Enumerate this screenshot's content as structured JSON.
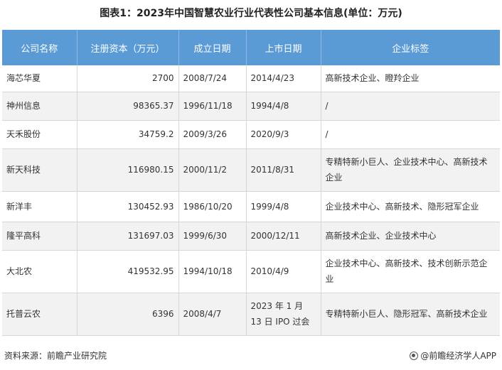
{
  "title": "图表1：2023年中国智慧农业行业代表性公司基本信息(单位：万元)",
  "table": {
    "headers": [
      "公司名称",
      "注册资本（万元）",
      "成立日期",
      "上市日期",
      "企业标签"
    ],
    "rows": [
      {
        "company": "海芯华夏",
        "capital": "2700",
        "founded": "2008/7/24",
        "listed": "2014/4/23",
        "tags": "高新技术企业、瞪羚企业"
      },
      {
        "company": "神州信息",
        "capital": "98365.37",
        "founded": "1996/11/18",
        "listed": "1994/4/8",
        "tags": "/"
      },
      {
        "company": "天禾股份",
        "capital": "34759.2",
        "founded": "2009/3/26",
        "listed": "2020/9/3",
        "tags": "/"
      },
      {
        "company": "新天科技",
        "capital": "116980.15",
        "founded": "2000/11/2",
        "listed": "2011/8/31",
        "tags": "专精特新小巨人、企业技术中心、高新技术企业"
      },
      {
        "company": "新洋丰",
        "capital": "130452.93",
        "founded": "1986/10/20",
        "listed": "1999/4/8",
        "tags": "企业技术中心、高新技术、隐形冠军企业"
      },
      {
        "company": "隆平高科",
        "capital": "131697.03",
        "founded": "1999/6/30",
        "listed": "2000/12/11",
        "tags": "高新技术企业、企业技术中心"
      },
      {
        "company": "大北农",
        "capital": "419532.95",
        "founded": "1994/10/18",
        "listed": "2010/4/9",
        "tags": "企业技术中心、高新技术、技术创新示范企业"
      },
      {
        "company": "托普云农",
        "capital": "6396",
        "founded": "2008/4/7",
        "listed": "2023 年 1 月 13 日 IPO 过会",
        "tags": "专精特新小巨人、隐形冠军、高新技术企业"
      }
    ]
  },
  "footer": {
    "source": "资料来源：前瞻产业研究院",
    "brand": "@前瞻经济学人APP"
  }
}
